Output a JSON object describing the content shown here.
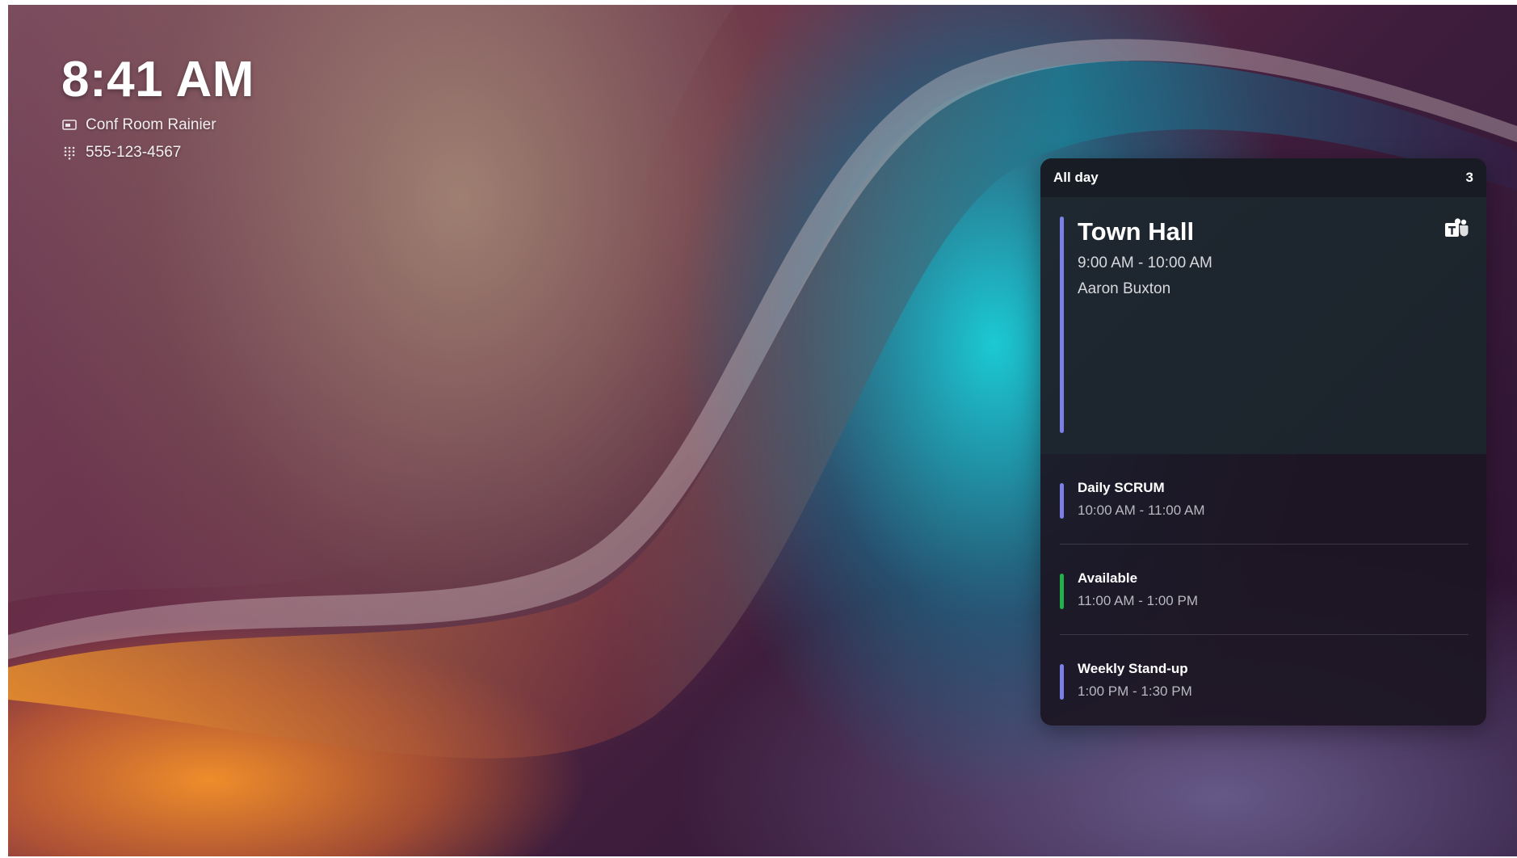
{
  "status": {
    "time": "8:41 AM",
    "room_name": "Conf Room Rainier",
    "phone": "555-123-4567",
    "room_icon": "room-display-icon",
    "phone_icon": "dialpad-icon"
  },
  "agenda": {
    "header_label": "All day",
    "count": "3",
    "featured": {
      "title": "Town Hall",
      "time": "9:00 AM - 10:00 AM",
      "organizer": "Aaron Buxton",
      "accent_color": "#7b7fe6",
      "app_icon": "teams-icon"
    },
    "events": [
      {
        "title": "Daily SCRUM",
        "time": "10:00 AM - 11:00 AM",
        "accent_color": "#7b7fe6"
      },
      {
        "title": "Available",
        "time": "11:00 AM - 1:00 PM",
        "accent_color": "#22b04a"
      },
      {
        "title": "Weekly Stand-up",
        "time": "1:00 PM - 1:30 PM",
        "accent_color": "#7b7fe6"
      }
    ]
  },
  "colors": {
    "panel_bg": "#1c1622",
    "featured_bg": "#1e2830",
    "teams_purple": "#6264a7"
  }
}
